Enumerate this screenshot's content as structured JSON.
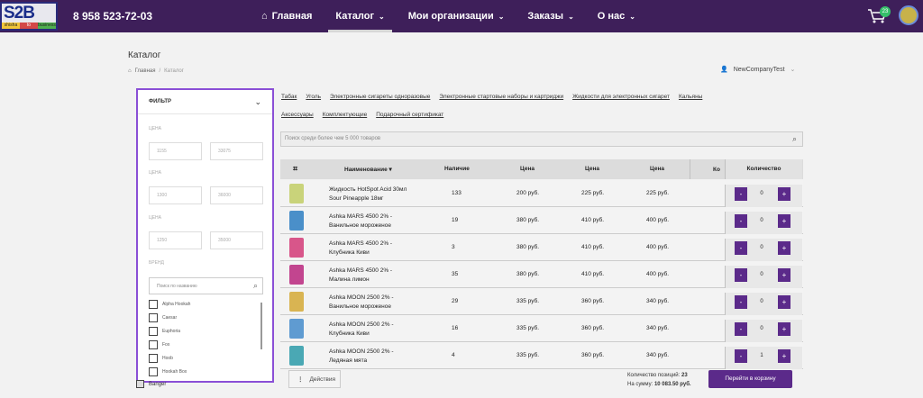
{
  "header": {
    "logo_text": "S2B",
    "logo_strip": [
      "shisha",
      "to",
      "business"
    ],
    "phone": "8 958 523-72-03",
    "nav": [
      {
        "label": "Главная",
        "chevron": false
      },
      {
        "label": "Каталог",
        "chevron": true
      },
      {
        "label": "Мои организации",
        "chevron": true
      },
      {
        "label": "Заказы",
        "chevron": true
      },
      {
        "label": "О нас",
        "chevron": true
      }
    ],
    "cart_count": "23",
    "colors": {
      "bar": "#3e1f5a",
      "accent": "#5b2a8a",
      "badge": "#36c06a",
      "filter_border": "#8a4fd6"
    }
  },
  "page": {
    "title": "Каталог",
    "breadcrumb": [
      "Главная",
      "Каталог"
    ],
    "user": "NewCompanyTest"
  },
  "filter": {
    "title": "ФИЛЬТР",
    "groups": [
      {
        "label": "ЦЕНА",
        "min": "1155",
        "max": "33075"
      },
      {
        "label": "ЦЕНА",
        "min": "1300",
        "max": "36000"
      },
      {
        "label": "ЦЕНА",
        "min": "1250",
        "max": "35000"
      }
    ],
    "brand_label": "БРЕНД",
    "brand_search_placeholder": "Поиск по названию",
    "brands": [
      "Alpha Hookah",
      "Caesar",
      "Euphoria",
      "Fox",
      "Hoob",
      "Hookah Box"
    ],
    "hidden_brand": "Banger"
  },
  "categories": [
    [
      "Табак",
      "Уголь",
      "Электронные сигареты одноразовые",
      "Электронные стартовые наборы и картриджи",
      "Жидкости для электронных сигарет",
      "Кальяны"
    ],
    [
      "Аксессуары",
      "Комплектующие",
      "Подарочный сертификат"
    ]
  ],
  "search_placeholder": "Поиск среди более чем 5 000 товаров",
  "table": {
    "headers": {
      "name": "Наименование ▾",
      "stock": "Наличие",
      "price1": "Цена",
      "price2": "Цена",
      "price3": "Цена",
      "ko": "Ко",
      "qty": "Количество"
    },
    "rows": [
      {
        "name": "Жидкость HotSpot Acid 30мл Sour Pineapple 18мг",
        "stock": "133",
        "p1": "200 руб.",
        "p2": "225 руб.",
        "p3": "225 руб.",
        "qty": "0",
        "img_color": "#c9d37a"
      },
      {
        "name": "Ashka MARS 4500 2% - Ванильное мороженое",
        "stock": "19",
        "p1": "380 руб.",
        "p2": "410 руб.",
        "p3": "400 руб.",
        "qty": "0",
        "img_color": "#4a8fc9"
      },
      {
        "name": "Ashka MARS 4500 2% - Клубника Киви",
        "stock": "3",
        "p1": "380 руб.",
        "p2": "410 руб.",
        "p3": "400 руб.",
        "qty": "0",
        "img_color": "#d8568a"
      },
      {
        "name": "Ashka MARS 4500 2% - Малина лимон",
        "stock": "35",
        "p1": "380 руб.",
        "p2": "410 руб.",
        "p3": "400 руб.",
        "qty": "0",
        "img_color": "#c2458f"
      },
      {
        "name": "Ashka MOON 2500 2% - Ванильное мороженое",
        "stock": "29",
        "p1": "335 руб.",
        "p2": "360 руб.",
        "p3": "340 руб.",
        "qty": "0",
        "img_color": "#d9b452"
      },
      {
        "name": "Ashka MOON 2500 2% - Клубника Киви",
        "stock": "16",
        "p1": "335 руб.",
        "p2": "360 руб.",
        "p3": "340 руб.",
        "qty": "0",
        "img_color": "#5f9bd1"
      },
      {
        "name": "Ashka MOON 2500 2% - Ледяная мята",
        "stock": "4",
        "p1": "335 руб.",
        "p2": "360 руб.",
        "p3": "340 руб.",
        "qty": "1",
        "img_color": "#4aa8b4"
      }
    ]
  },
  "footer": {
    "actions_label": "Действия",
    "count_label": "Количество позиций:",
    "count_value": "23",
    "sum_label": "На сумму:",
    "sum_value": "10 083.50 руб.",
    "cart_button": "Перейти в корзину"
  }
}
